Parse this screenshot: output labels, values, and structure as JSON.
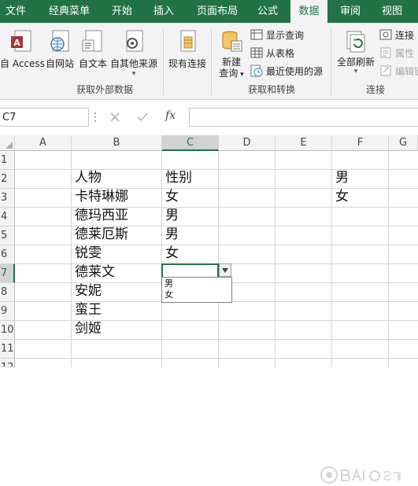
{
  "tabs": [
    {
      "label": "文件"
    },
    {
      "label": "经典菜单"
    },
    {
      "label": "开始"
    },
    {
      "label": "插入"
    },
    {
      "label": "页面布局"
    },
    {
      "label": "公式"
    },
    {
      "label": "数据",
      "active": true
    },
    {
      "label": "审阅"
    },
    {
      "label": "视图"
    }
  ],
  "ribbon": {
    "get_external": {
      "access": "自 Access",
      "web": "自网站",
      "text": "自文本",
      "other_1": "自其他来源",
      "existing": "现有连接",
      "group_label": "获取外部数据"
    },
    "get_transform": {
      "new_query_1": "新建",
      "new_query_2": "查询",
      "show_queries": "显示查询",
      "from_table": "从表格",
      "recent_sources": "最近使用的源",
      "group_label": "获取和转换"
    },
    "connections": {
      "refresh_all": "全部刷新",
      "connections": "连接",
      "properties": "属性",
      "edit_links": "编辑链",
      "group_label": "连接"
    }
  },
  "formula_bar": {
    "name_box": "C7",
    "fx": "fx",
    "formula": ""
  },
  "grid": {
    "columns": [
      "A",
      "B",
      "C",
      "D",
      "E",
      "F",
      "G"
    ],
    "selected_column": "C",
    "rows": [
      "1",
      "2",
      "3",
      "4",
      "5",
      "6",
      "7",
      "8",
      "9",
      "10",
      "11",
      "12"
    ],
    "selected_row": "7",
    "cells": {
      "B2": "人物",
      "C2": "性别",
      "F2": "男",
      "B3": "卡特琳娜",
      "C3": "女",
      "F3": "女",
      "B4": "德玛西亚",
      "C4": "男",
      "B5": "德莱厄斯",
      "C5": "男",
      "B6": "锐雯",
      "C6": "女",
      "B7": "德莱文",
      "B8": "安妮",
      "B9": "蛮王",
      "B10": "剑姬"
    },
    "active_cell": "C7",
    "dropdown_options": [
      "男",
      "女"
    ]
  },
  "colors": {
    "accent": "#217346",
    "ribbon_bg": "#f3f3f3"
  }
}
